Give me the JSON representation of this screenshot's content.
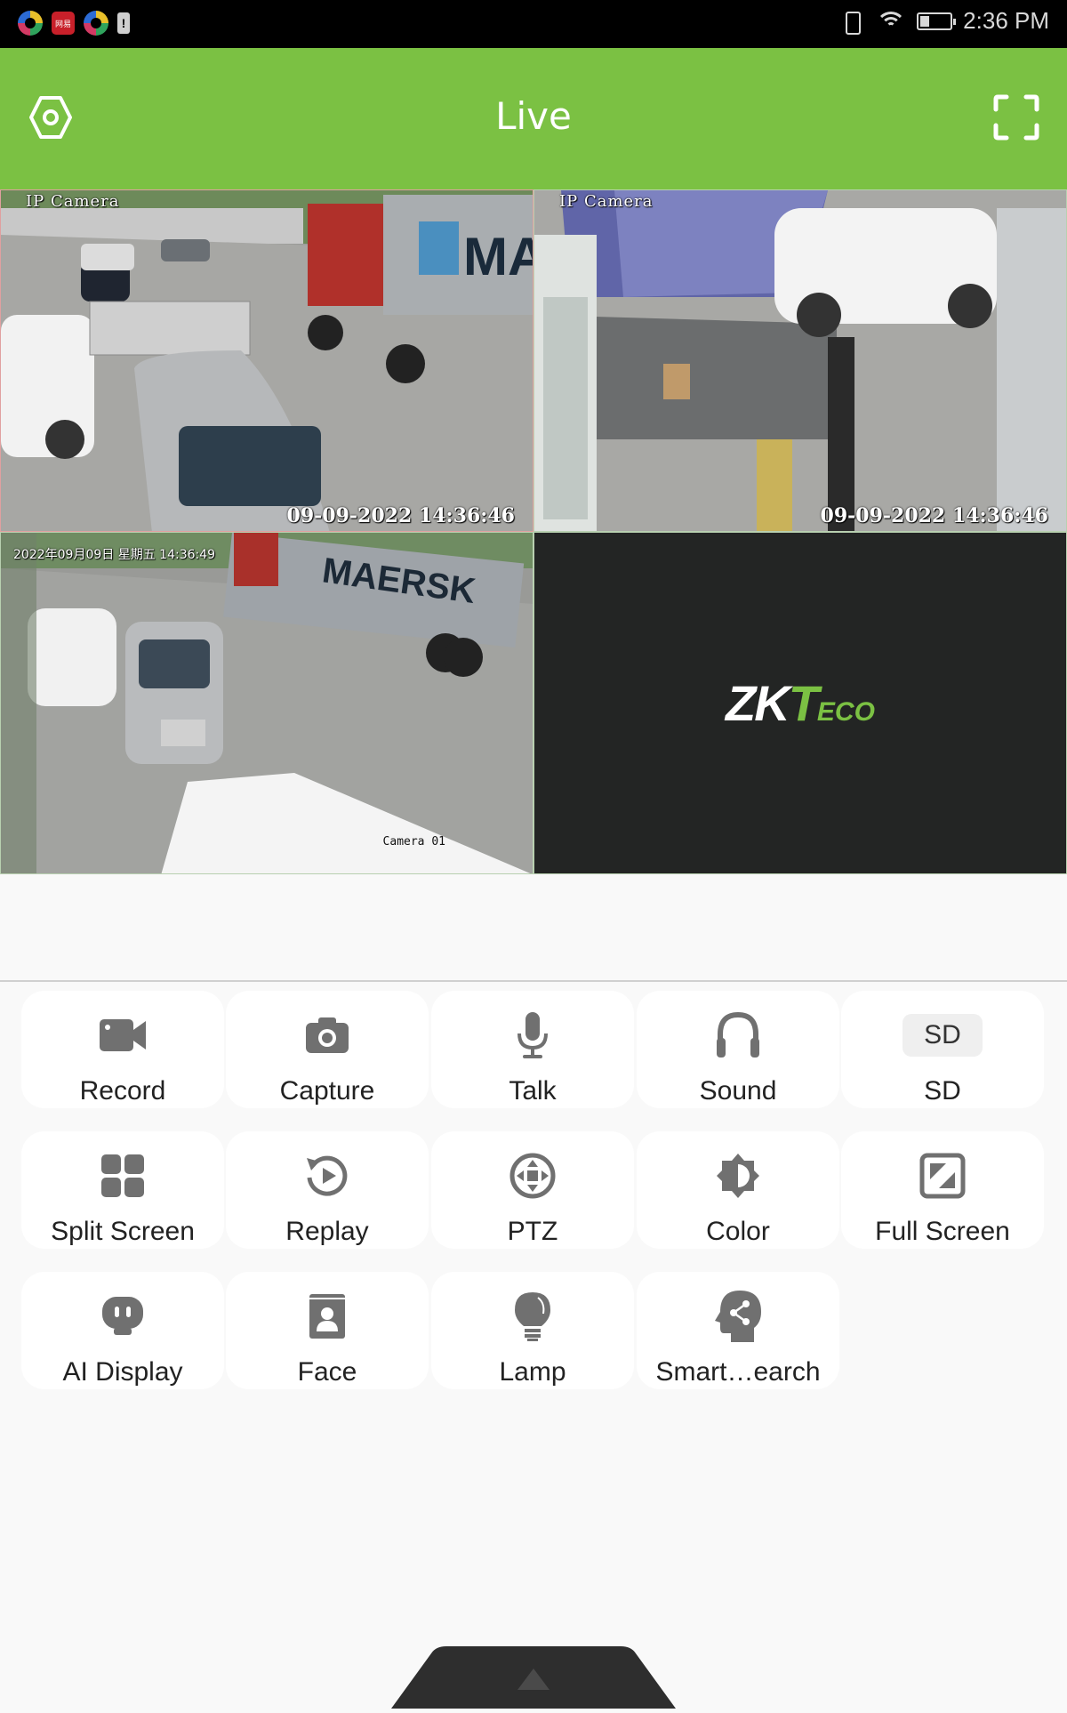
{
  "status_bar": {
    "notification_icons": [
      "app-icon",
      "news-app-icon",
      "app-icon",
      "alert-icon"
    ],
    "news_icon_text": "网易",
    "battery_level": 0.3,
    "time": "2:36 PM"
  },
  "header": {
    "title": "Live",
    "left_icon": "settings-hex-icon",
    "right_icon": "fullscreen-icon"
  },
  "colors": {
    "brand_green": "#7bc143",
    "icon_gray": "#707070",
    "logo_bg": "#232524"
  },
  "video_grid": {
    "panes": [
      {
        "osd_name": "IP Camera",
        "osd_time": "09-09-2022 14:36:46",
        "selected": true
      },
      {
        "osd_name": "IP Camera",
        "osd_time": "09-09-2022 14:36:46",
        "selected": false
      },
      {
        "osd_time": "2022年09月09日 星期五 14:36:49",
        "osd_name": "Camera 01",
        "selected": false
      },
      {
        "logo_main": "ZK",
        "logo_t": "T",
        "logo_eco": "ECO"
      }
    ]
  },
  "actions": [
    {
      "label": "Record",
      "icon": "video-camera-icon"
    },
    {
      "label": "Capture",
      "icon": "camera-icon"
    },
    {
      "label": "Talk",
      "icon": "microphone-icon"
    },
    {
      "label": "Sound",
      "icon": "headphones-icon"
    },
    {
      "label": "SD",
      "icon": "sd-card-icon",
      "badge": "SD"
    },
    {
      "label": "Split Screen",
      "icon": "grid-icon"
    },
    {
      "label": "Replay",
      "icon": "replay-icon"
    },
    {
      "label": "PTZ",
      "icon": "ptz-icon"
    },
    {
      "label": "Color",
      "icon": "brightness-icon"
    },
    {
      "label": "Full Screen",
      "icon": "aspect-ratio-icon"
    },
    {
      "label": "AI Display",
      "icon": "robot-icon"
    },
    {
      "label": "Face",
      "icon": "contact-book-icon"
    },
    {
      "label": "Lamp",
      "icon": "lightbulb-icon"
    },
    {
      "label": "Smart…earch",
      "icon": "head-share-icon"
    }
  ],
  "bottom_handle": {
    "icon": "chevron-up-icon"
  }
}
